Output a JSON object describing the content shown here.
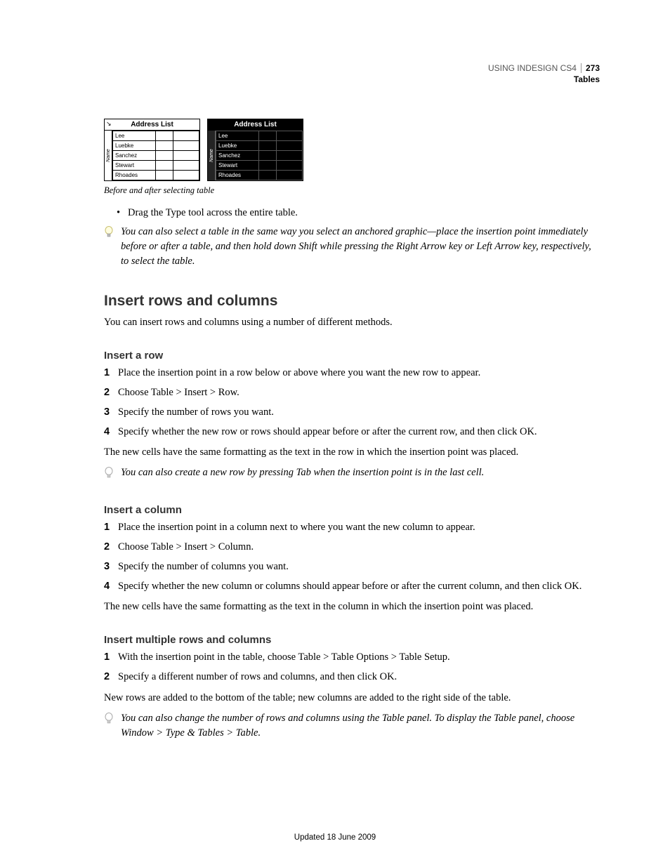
{
  "header": {
    "book_title": "USING INDESIGN CS4",
    "page_number": "273",
    "chapter": "Tables"
  },
  "figure": {
    "table_title": "Address List",
    "side_label": "Name",
    "rows": [
      "Lee",
      "Luebke",
      "Sanchez",
      "Stewart",
      "Rhoades"
    ],
    "caption": "Before and after selecting table"
  },
  "bullet_item": "Drag the Type tool across the entire table.",
  "tip1": "You can also select a table in the same way you select an anchored graphic—place the insertion point immediately before or after a table, and then hold down Shift while pressing the Right Arrow key or Left Arrow key, respectively, to select the table.",
  "section_heading": "Insert rows and columns",
  "section_intro": "You can insert rows and columns using a number of different methods.",
  "sub1": {
    "heading": "Insert a row",
    "steps": [
      "Place the insertion point in a row below or above where you want the new row to appear.",
      "Choose Table > Insert > Row.",
      "Specify the number of rows you want.",
      "Specify whether the new row or rows should appear before or after the current row, and then click OK."
    ],
    "followup": "The new cells have the same formatting as the text in the row in which the insertion point was placed.",
    "tip": "You can also create a new row by pressing Tab when the insertion point is in the last cell."
  },
  "sub2": {
    "heading": "Insert a column",
    "steps": [
      "Place the insertion point in a column next to where you want the new column to appear.",
      "Choose Table > Insert > Column.",
      "Specify the number of columns you want.",
      "Specify whether the new column or columns should appear before or after the current column, and then click OK."
    ],
    "followup": "The new cells have the same formatting as the text in the column in which the insertion point was placed."
  },
  "sub3": {
    "heading": "Insert multiple rows and columns",
    "steps": [
      "With the insertion point in the table, choose Table > Table Options > Table Setup.",
      "Specify a different number of rows and columns, and then click OK."
    ],
    "followup": "New rows are added to the bottom of the table; new columns are added to the right side of the table.",
    "tip": "You can also change the number of rows and columns using the Table panel. To display the Table panel, choose Window > Type & Tables > Table."
  },
  "footer": "Updated 18 June 2009"
}
